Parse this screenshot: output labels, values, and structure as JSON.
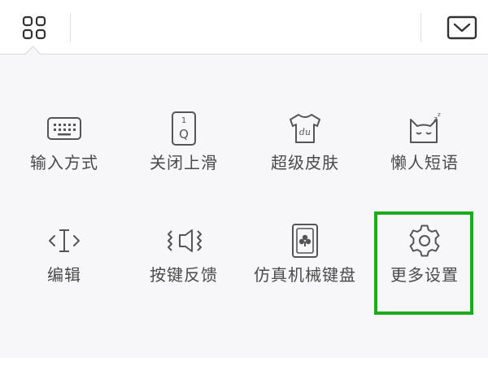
{
  "topbar": {
    "left_icon": "grid-icon",
    "right_icon": "collapse-keyboard-icon"
  },
  "menu": {
    "items": [
      {
        "label": "输入方式",
        "icon": "keyboard-icon"
      },
      {
        "label": "关闭上滑",
        "icon": "slide-up-q-icon"
      },
      {
        "label": "超级皮肤",
        "icon": "skin-tshirt-icon"
      },
      {
        "label": "懒人短语",
        "icon": "sleeping-cat-icon"
      },
      {
        "label": "编辑",
        "icon": "text-cursor-icon"
      },
      {
        "label": "按键反馈",
        "icon": "vibration-feedback-icon"
      },
      {
        "label": "仿真机械键盘",
        "icon": "mechanical-keycap-icon"
      },
      {
        "label": "更多设置",
        "icon": "gear-icon"
      }
    ]
  },
  "colors": {
    "icon_stroke": "#555555",
    "label_text": "#4a4a4a",
    "highlight": "#1eaa1e",
    "panel_bg": "#f7f7f9"
  }
}
